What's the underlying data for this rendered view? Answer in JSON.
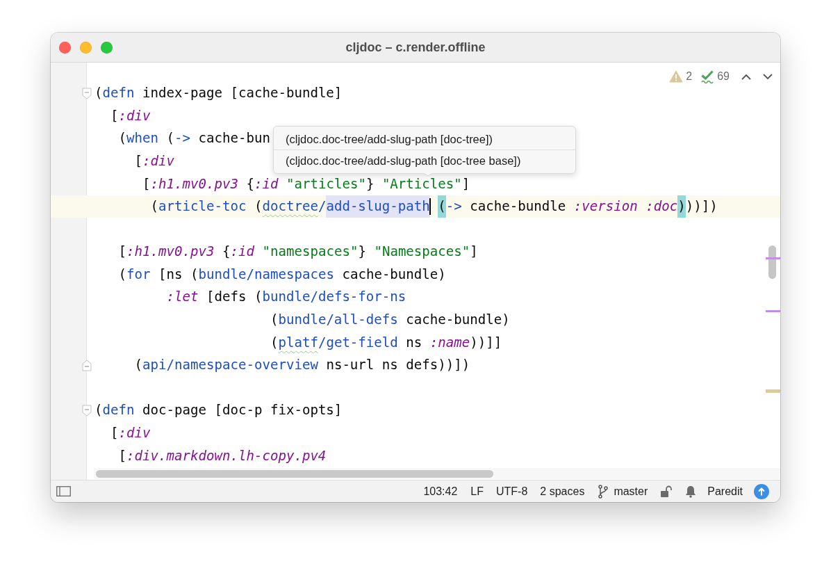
{
  "window": {
    "title": "cljdoc – c.render.offline"
  },
  "inspections": {
    "warning_count": "2",
    "check_count": "69"
  },
  "editor": {
    "lines": [
      {
        "kind": "fold_start",
        "current": false,
        "tokens": [
          {
            "text": "(",
            "kind": "plain"
          },
          {
            "text": "defn",
            "kind": "call"
          },
          {
            "text": " index-page [cache-bundle]",
            "kind": "plain"
          }
        ]
      },
      {
        "kind": "plain",
        "current": false,
        "tokens": [
          {
            "text": "  [",
            "kind": "plain"
          },
          {
            "text": ":div",
            "kind": "keyword"
          }
        ]
      },
      {
        "kind": "plain",
        "current": false,
        "tokens": [
          {
            "text": "   (",
            "kind": "plain"
          },
          {
            "text": "when",
            "kind": "call"
          },
          {
            "text": " (",
            "kind": "plain"
          },
          {
            "text": "->",
            "kind": "call"
          },
          {
            "text": " cache-bun",
            "kind": "plain"
          }
        ]
      },
      {
        "kind": "plain",
        "current": false,
        "tokens": [
          {
            "text": "     [",
            "kind": "plain"
          },
          {
            "text": ":div",
            "kind": "keyword"
          }
        ]
      },
      {
        "kind": "plain",
        "current": false,
        "tokens": [
          {
            "text": "      [",
            "kind": "plain"
          },
          {
            "text": ":h1.mv0.pv3",
            "kind": "keyword"
          },
          {
            "text": " {",
            "kind": "plain"
          },
          {
            "text": ":id",
            "kind": "keyword"
          },
          {
            "text": " \"articles\"",
            "kind": "string"
          },
          {
            "text": "} ",
            "kind": "plain"
          },
          {
            "text": "\"Articles\"",
            "kind": "string"
          },
          {
            "text": "]",
            "kind": "plain"
          }
        ]
      },
      {
        "kind": "plain",
        "current": true,
        "tokens": [
          {
            "text": "       (",
            "kind": "plain"
          },
          {
            "text": "article-toc",
            "kind": "call"
          },
          {
            "text": " (",
            "kind": "plain"
          },
          {
            "text": "doctree",
            "kind": "typo"
          },
          {
            "text": "/",
            "kind": "call"
          },
          {
            "text": "add-slug-path",
            "kind": "usage"
          },
          {
            "kind": "caret"
          },
          {
            "text": "(",
            "kind": "brace"
          },
          {
            "text": "->",
            "kind": "call"
          },
          {
            "text": " cache-bundle ",
            "kind": "plain"
          },
          {
            "text": ":version",
            "kind": "keyword"
          },
          {
            "text": " :doc",
            "kind": "keyword"
          },
          {
            "text": ")",
            "kind": "brace"
          },
          {
            "text": "))])",
            "kind": "plain"
          }
        ]
      },
      {
        "kind": "plain",
        "current": false
      },
      {
        "kind": "plain",
        "current": false,
        "tokens": [
          {
            "text": "   [",
            "kind": "plain"
          },
          {
            "text": ":h1.mv0.pv3",
            "kind": "keyword"
          },
          {
            "text": " {",
            "kind": "plain"
          },
          {
            "text": ":id",
            "kind": "keyword"
          },
          {
            "text": " \"namespaces\"",
            "kind": "string"
          },
          {
            "text": "} ",
            "kind": "plain"
          },
          {
            "text": "\"Namespaces\"",
            "kind": "string"
          },
          {
            "text": "]",
            "kind": "plain"
          }
        ]
      },
      {
        "kind": "plain",
        "current": false,
        "tokens": [
          {
            "text": "   (",
            "kind": "plain"
          },
          {
            "text": "for",
            "kind": "call"
          },
          {
            "text": " [ns (",
            "kind": "plain"
          },
          {
            "text": "bundle/namespaces",
            "kind": "call"
          },
          {
            "text": " cache-bundle)",
            "kind": "plain"
          }
        ]
      },
      {
        "kind": "plain",
        "current": false,
        "tokens": [
          {
            "text": "         :let",
            "kind": "keyword"
          },
          {
            "text": " [defs (",
            "kind": "plain"
          },
          {
            "text": "bundle/defs-for-ns",
            "kind": "call"
          }
        ]
      },
      {
        "kind": "plain",
        "current": false,
        "tokens": [
          {
            "text": "                      (",
            "kind": "plain"
          },
          {
            "text": "bundle/all-defs",
            "kind": "call"
          },
          {
            "text": " cache-bundle)",
            "kind": "plain"
          }
        ]
      },
      {
        "kind": "plain",
        "current": false,
        "tokens": [
          {
            "text": "                      (",
            "kind": "plain"
          },
          {
            "text": "platf",
            "kind": "typo"
          },
          {
            "text": "/get-field",
            "kind": "call"
          },
          {
            "text": " ns ",
            "kind": "plain"
          },
          {
            "text": ":name",
            "kind": "keyword"
          },
          {
            "text": "))]]",
            "kind": "plain"
          }
        ]
      },
      {
        "kind": "fold_end",
        "current": false,
        "tokens": [
          {
            "text": "     (",
            "kind": "plain"
          },
          {
            "text": "api/namespace-overview",
            "kind": "call"
          },
          {
            "text": " ns-url ns defs))])",
            "kind": "plain"
          }
        ]
      },
      {
        "kind": "plain",
        "current": false
      },
      {
        "kind": "fold_start",
        "current": false,
        "tokens": [
          {
            "text": "(",
            "kind": "plain"
          },
          {
            "text": "defn",
            "kind": "call"
          },
          {
            "text": " doc-page [doc-p fix-opts]",
            "kind": "plain"
          }
        ]
      },
      {
        "kind": "plain",
        "current": false,
        "tokens": [
          {
            "text": "  [",
            "kind": "plain"
          },
          {
            "text": ":div",
            "kind": "keyword"
          }
        ]
      },
      {
        "kind": "plain",
        "current": false,
        "tokens": [
          {
            "text": "   [",
            "kind": "plain"
          },
          {
            "text": ":div.markdown.lh-copy.pv4",
            "kind": "keyword"
          }
        ]
      }
    ]
  },
  "parameter_info": {
    "items": [
      "(cljdoc.doc-tree/add-slug-path [doc-tree])",
      "(cljdoc.doc-tree/add-slug-path [doc-tree base])"
    ]
  },
  "error_stripe": [
    {
      "color": "#c48ee8"
    },
    {
      "color": "#c48ee8"
    },
    {
      "color": "#d9cca2"
    }
  ],
  "status_bar": {
    "position": "103:42",
    "line_separator": "LF",
    "encoding": "UTF-8",
    "indent": "2 spaces",
    "branch": "master",
    "mode": "Paredit"
  }
}
